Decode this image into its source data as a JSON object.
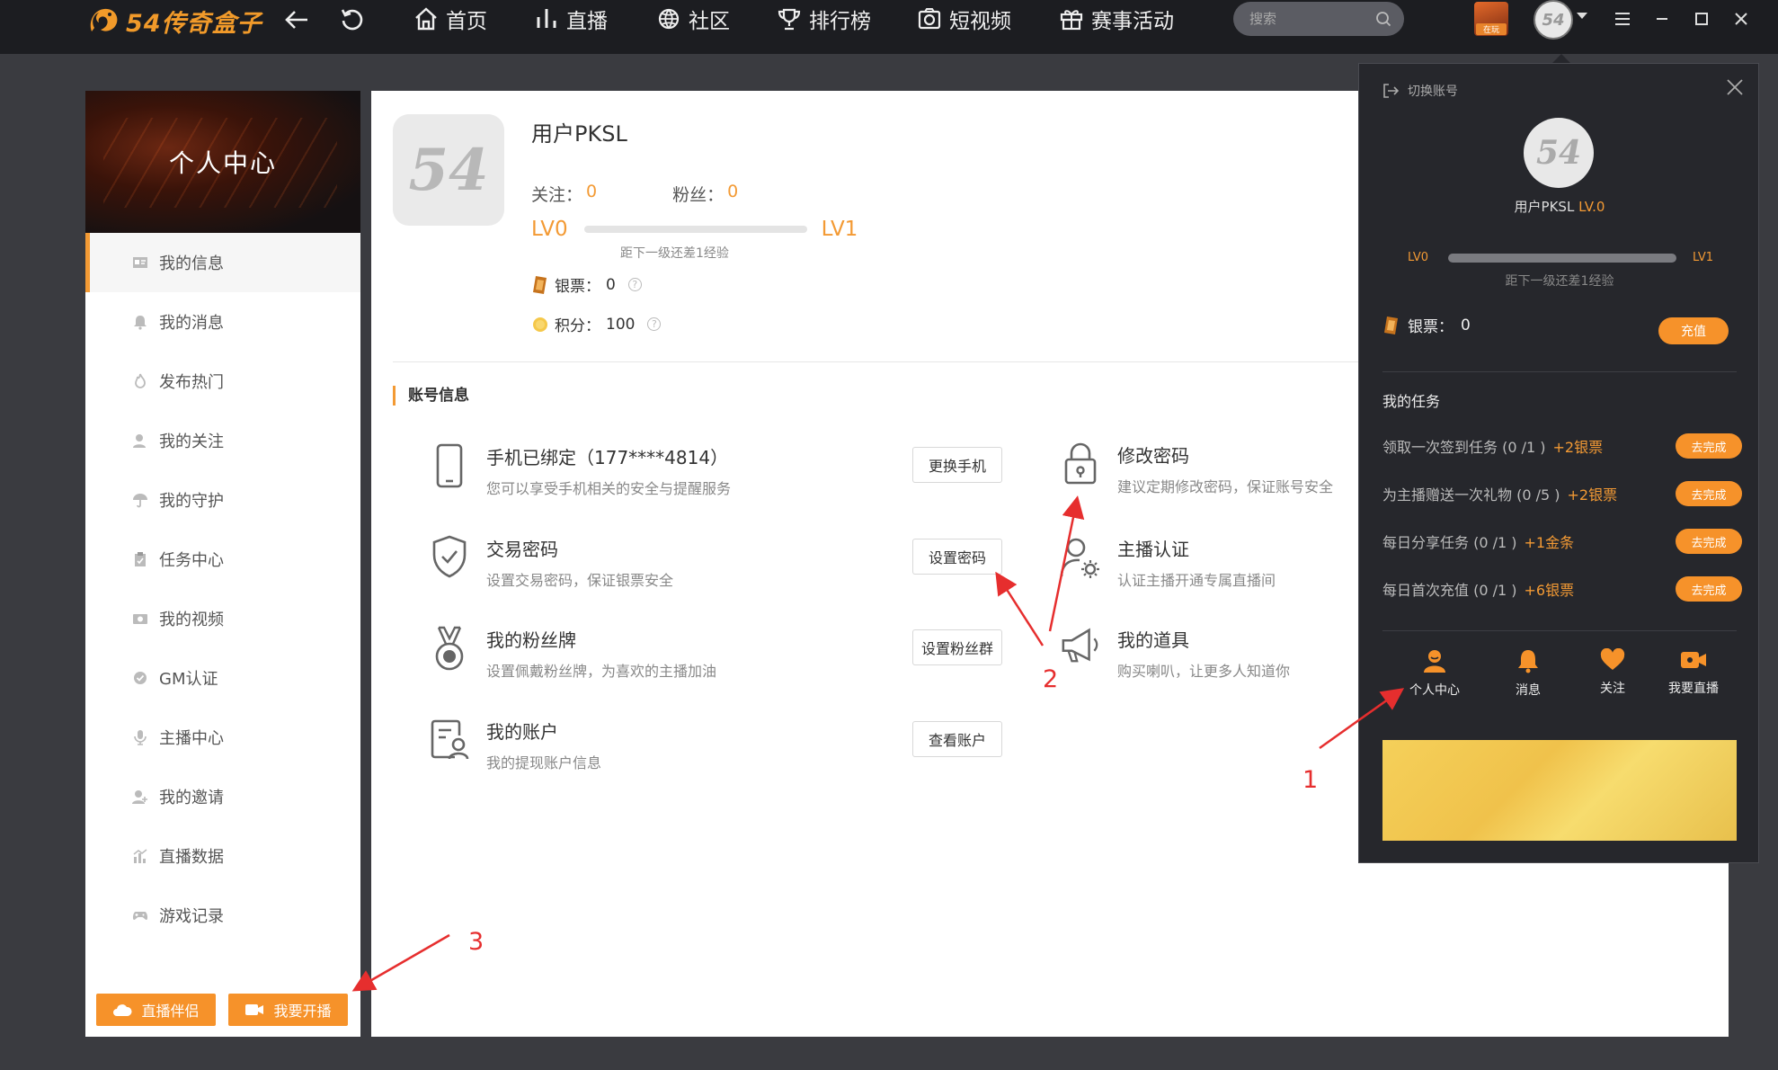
{
  "app": {
    "logo_text": "54传奇盒子"
  },
  "nav": {
    "items": [
      {
        "label": "首页",
        "icon": "home-icon"
      },
      {
        "label": "直播",
        "icon": "bars-icon"
      },
      {
        "label": "社区",
        "icon": "globe-icon"
      },
      {
        "label": "排行榜",
        "icon": "trophy-icon"
      },
      {
        "label": "短视频",
        "icon": "camera-icon"
      },
      {
        "label": "赛事活动",
        "icon": "gift-icon"
      }
    ],
    "search_placeholder": "搜索",
    "game_badge": "在玩"
  },
  "sidebar": {
    "title": "个人中心",
    "items": [
      {
        "label": "我的信息",
        "icon": "id-card-icon",
        "active": true
      },
      {
        "label": "我的消息",
        "icon": "bell-icon"
      },
      {
        "label": "发布热门",
        "icon": "flame-icon"
      },
      {
        "label": "我的关注",
        "icon": "user-follow-icon"
      },
      {
        "label": "我的守护",
        "icon": "umbrella-icon"
      },
      {
        "label": "任务中心",
        "icon": "clipboard-icon"
      },
      {
        "label": "我的视频",
        "icon": "video-icon"
      },
      {
        "label": "GM认证",
        "icon": "badge-check-icon"
      },
      {
        "label": "主播中心",
        "icon": "microphone-icon"
      },
      {
        "label": "我的邀请",
        "icon": "user-invite-icon"
      },
      {
        "label": "直播数据",
        "icon": "chart-icon"
      },
      {
        "label": "游戏记录",
        "icon": "gamepad-icon"
      }
    ],
    "bottom_buttons": [
      {
        "label": "直播伴侣",
        "icon": "cloud-icon"
      },
      {
        "label": "我要开播",
        "icon": "video-camera-icon"
      }
    ]
  },
  "profile": {
    "avatar_text": "54",
    "username": "用户PKSL",
    "follow_label": "关注：",
    "follow_count": "0",
    "fans_label": "粉丝：",
    "fans_count": "0",
    "level_current": "LV0",
    "level_next": "LV1",
    "level_progress": 0,
    "level_hint": "距下一级还差1经验",
    "silver_label": "银票：",
    "silver_value": "0",
    "points_label": "积分：",
    "points_value": "100"
  },
  "account": {
    "section_title": "账号信息",
    "items": [
      {
        "title": "手机已绑定（177****4814）",
        "desc": "您可以享受手机相关的安全与提醒服务",
        "button": "更换手机",
        "icon": "phone-icon"
      },
      {
        "title": "交易密码",
        "desc": "设置交易密码，保证银票安全",
        "button": "设置密码",
        "icon": "shield-check-icon"
      },
      {
        "title": "我的粉丝牌",
        "desc": "设置佩戴粉丝牌，为喜欢的主播加油",
        "button": "设置粉丝群",
        "icon": "medal-icon"
      },
      {
        "title": "我的账户",
        "desc": "我的提现账户信息",
        "button": "查看账户",
        "icon": "account-card-icon"
      }
    ],
    "right_items": [
      {
        "title": "修改密码",
        "desc": "建议定期修改密码，保证账号安全",
        "icon": "lock-icon"
      },
      {
        "title": "主播认证",
        "desc": "认证主播开通专属直播间",
        "icon": "user-gear-icon"
      },
      {
        "title": "我的道具",
        "desc": "购买喇叭，让更多人知道你",
        "icon": "megaphone-icon"
      }
    ]
  },
  "popup": {
    "switch_account": "切换账号",
    "avatar_text": "54",
    "username": "用户PKSL",
    "level": "LV.0",
    "level_current": "LV0",
    "level_next": "LV1",
    "level_progress": 0,
    "level_hint": "距下一级还差1经验",
    "silver_label": "银票：",
    "silver_value": "0",
    "recharge": "充值",
    "tasks_title": "我的任务",
    "tasks": [
      {
        "name": "领取一次签到任务 (0 /1 )",
        "reward": "+2银票",
        "button": "去完成"
      },
      {
        "name": "为主播赠送一次礼物 (0 /5 )",
        "reward": "+2银票",
        "button": "去完成"
      },
      {
        "name": "每日分享任务 (0 /1 )",
        "reward": "+1金条",
        "button": "去完成"
      },
      {
        "name": "每日首次充值 (0 /1 )",
        "reward": "+6银票",
        "button": "去完成"
      }
    ],
    "nav": [
      {
        "label": "个人中心",
        "icon": "person-icon"
      },
      {
        "label": "消息",
        "icon": "bell-icon"
      },
      {
        "label": "关注",
        "icon": "heart-icon"
      },
      {
        "label": "我要直播",
        "icon": "video-camera-icon"
      }
    ]
  },
  "annotations": [
    "1",
    "2",
    "3"
  ],
  "colors": {
    "accent": "#f39a34",
    "button_orange": "#f6922a",
    "topbar": "#1c1d21",
    "background": "#3a3b40",
    "popup": "#26272c",
    "annotation": "#e62e2e"
  }
}
